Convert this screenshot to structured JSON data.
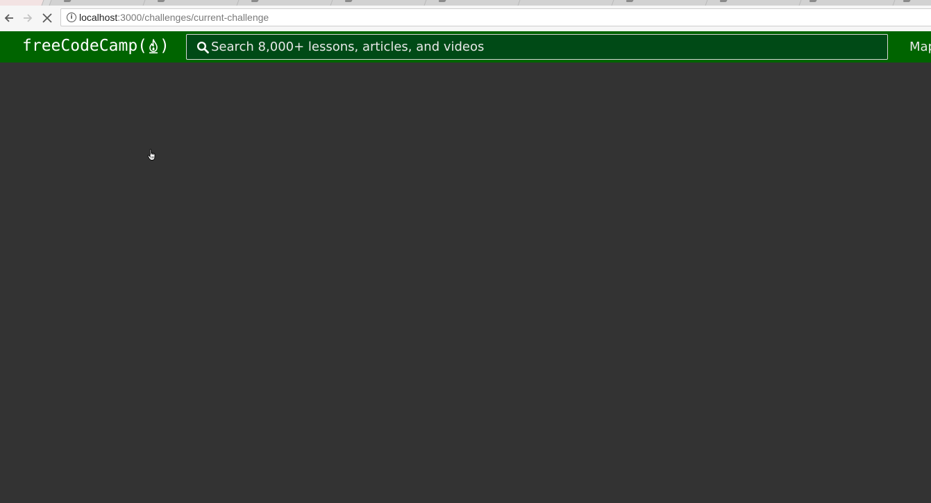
{
  "browser": {
    "url_host": "localhost",
    "url_path": ":3000/challenges/current-challenge",
    "back_icon": "back-arrow-icon",
    "forward_icon": "forward-arrow-icon",
    "stop_icon": "stop-loading-icon",
    "info_icon": "info-icon"
  },
  "navbar": {
    "logo_prefix": "freeCodeCamp(",
    "logo_suffix": ")",
    "search_placeholder": "Search 8,000+ lessons, articles, and videos",
    "map_link": "Map",
    "background_color": "#006400",
    "search_background": "#004a16"
  },
  "content": {
    "background_color": "#333333"
  }
}
